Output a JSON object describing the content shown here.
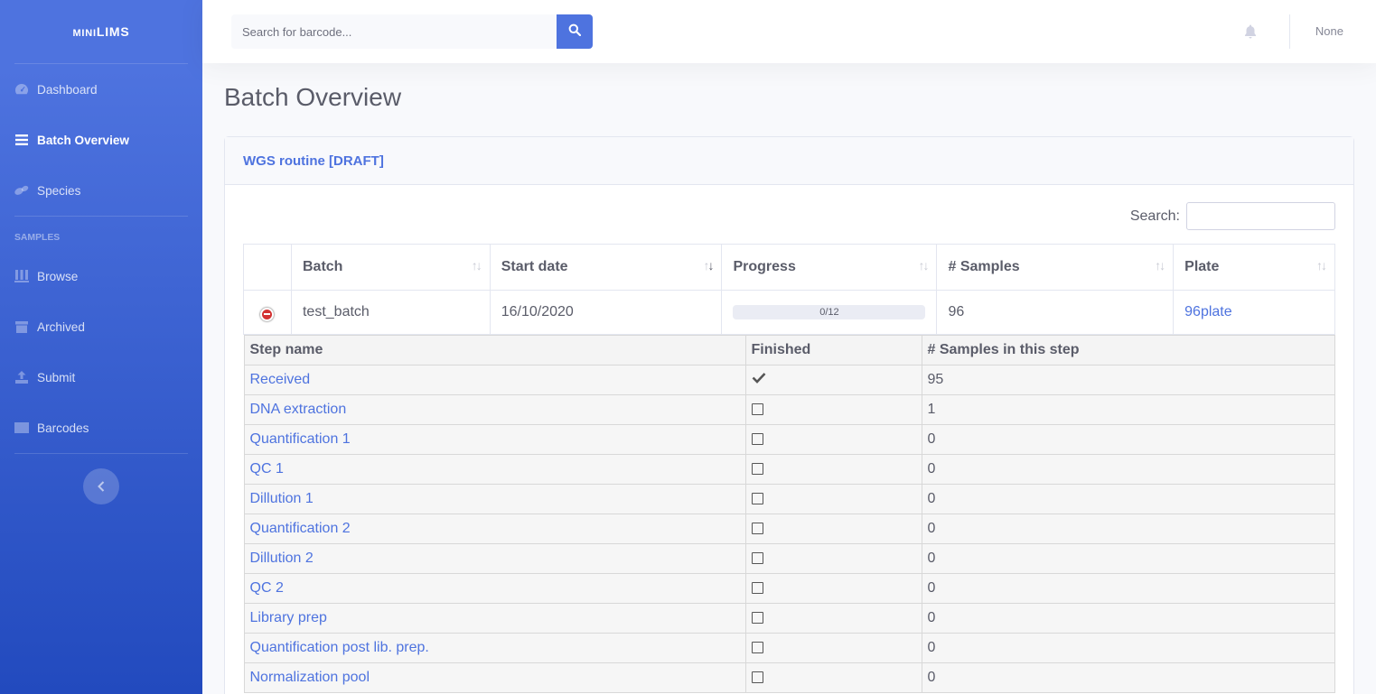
{
  "brand": {
    "mini": "mini",
    "lims": "LIMS"
  },
  "sidebar": {
    "items": [
      {
        "label": "Dashboard",
        "icon": "tachometer-icon"
      },
      {
        "label": "Batch Overview",
        "icon": "list-icon",
        "active": true
      },
      {
        "label": "Species",
        "icon": "bacteria-icon"
      }
    ],
    "section_heading": "SAMPLES",
    "sample_items": [
      {
        "label": "Browse",
        "icon": "vials-icon"
      },
      {
        "label": "Archived",
        "icon": "archive-icon"
      },
      {
        "label": "Submit",
        "icon": "upload-icon"
      },
      {
        "label": "Barcodes",
        "icon": "barcode-icon"
      }
    ]
  },
  "topbar": {
    "search_placeholder": "Search for barcode...",
    "user": "None"
  },
  "page": {
    "title": "Batch Overview"
  },
  "card": {
    "title": "WGS routine [DRAFT]",
    "search_label": "Search:"
  },
  "table": {
    "headers": [
      "Batch",
      "Start date",
      "Progress",
      "# Samples",
      "Plate"
    ],
    "row": {
      "batch": "test_batch",
      "start_date": "16/10/2020",
      "progress_text": "0/12",
      "progress_value": 0,
      "samples": "96",
      "plate": "96plate"
    }
  },
  "steps": {
    "headers": [
      "Step name",
      "Finished",
      "# Samples in this step"
    ],
    "rows": [
      {
        "name": "Received",
        "finished": true,
        "count": "95"
      },
      {
        "name": "DNA extraction",
        "finished": false,
        "count": "1"
      },
      {
        "name": "Quantification 1",
        "finished": false,
        "count": "0"
      },
      {
        "name": "QC 1",
        "finished": false,
        "count": "0"
      },
      {
        "name": "Dillution 1",
        "finished": false,
        "count": "0"
      },
      {
        "name": "Quantification 2",
        "finished": false,
        "count": "0"
      },
      {
        "name": "Dillution 2",
        "finished": false,
        "count": "0"
      },
      {
        "name": "QC 2",
        "finished": false,
        "count": "0"
      },
      {
        "name": "Library prep",
        "finished": false,
        "count": "0"
      },
      {
        "name": "Quantification post lib. prep.",
        "finished": false,
        "count": "0"
      },
      {
        "name": "Normalization pool",
        "finished": false,
        "count": "0"
      }
    ]
  },
  "colors": {
    "primary": "#4e73df",
    "sidebar_end": "#224abe",
    "danger": "#d33333"
  }
}
